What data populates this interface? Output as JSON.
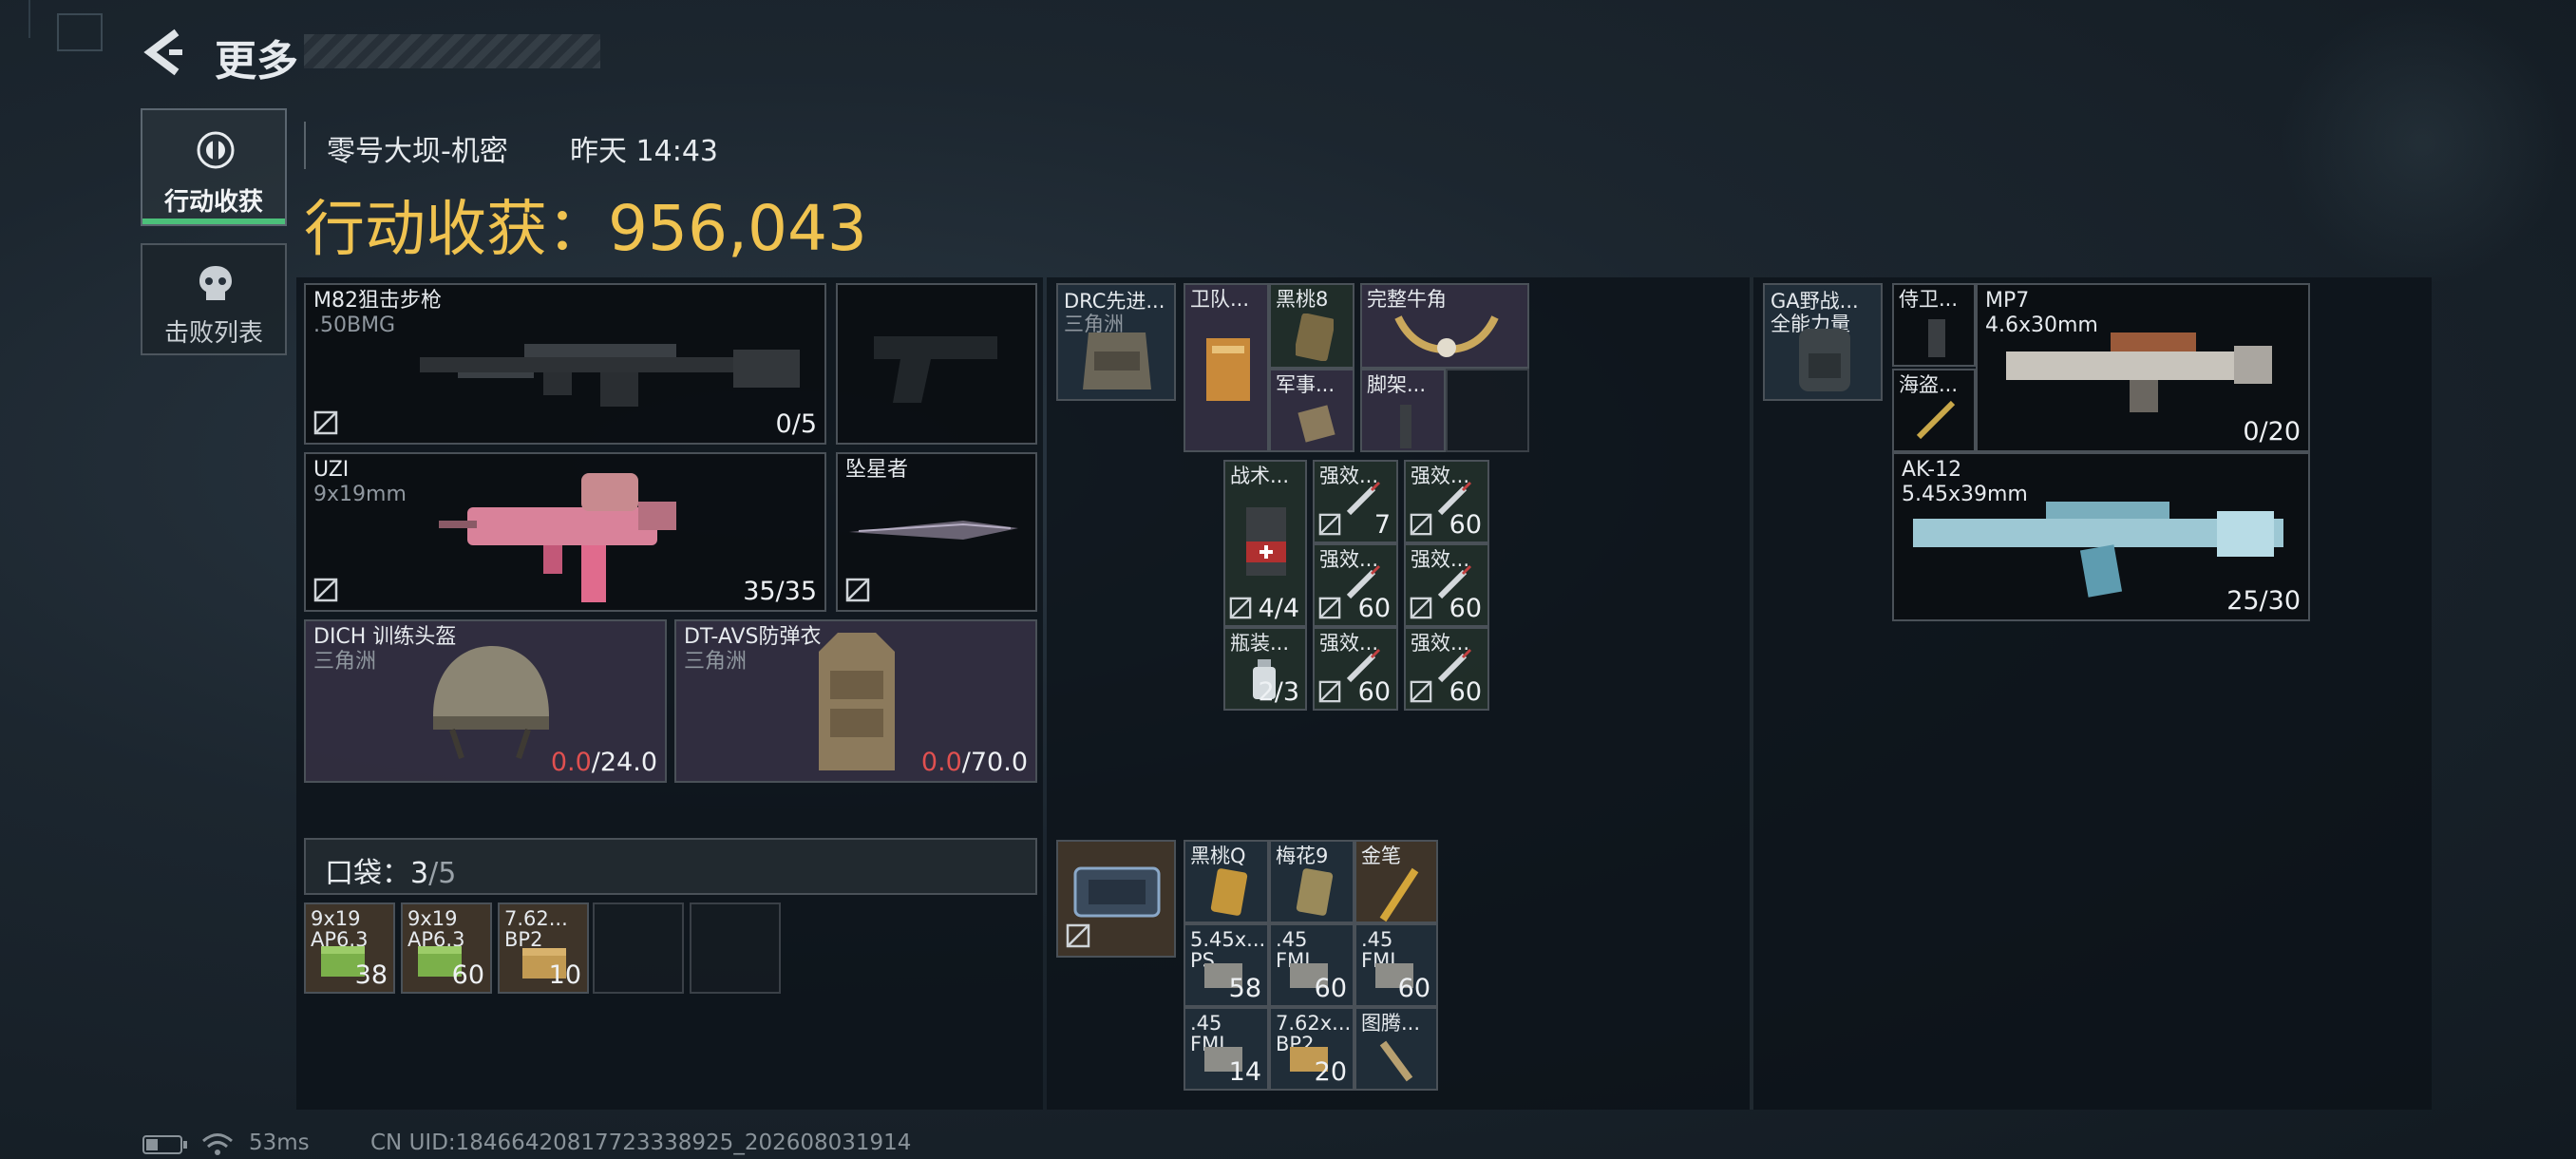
{
  "header": {
    "back_label": "更多"
  },
  "sidebar": {
    "tabs": [
      {
        "label": "行动收获",
        "icon": "loot-icon",
        "active": true
      },
      {
        "label": "击败列表",
        "icon": "skull-icon",
        "active": false
      }
    ]
  },
  "match": {
    "map": "零号大坝-机密",
    "time": "昨天 14:43"
  },
  "loot": {
    "label": "行动收获：",
    "value": "956,043"
  },
  "weapons": {
    "primary1": {
      "name": "M82狙击步枪",
      "ammo": ".50BMG",
      "count": "0/5"
    },
    "primary2": {
      "name": "UZI",
      "ammo": "9x19mm",
      "count": "35/35"
    },
    "melee": {
      "name": "坠星者"
    },
    "helmet": {
      "name": "DICH 训练头盔",
      "origin": "三角洲",
      "cur": "0.0",
      "max": "/24.0"
    },
    "armor": {
      "name": "DT-AVS防弹衣",
      "origin": "三角洲",
      "cur": "0.0",
      "max": "/70.0"
    }
  },
  "pocket": {
    "label": "口袋：",
    "current": "3",
    "total": "/5",
    "items": [
      {
        "name": "9x19",
        "sub": "AP6.3",
        "count": "38"
      },
      {
        "name": "9x19",
        "sub": "AP6.3",
        "count": "60"
      },
      {
        "name": "7.62...",
        "sub": "BP2",
        "count": "10"
      }
    ]
  },
  "chest_rig": {
    "name": "DRC先进...",
    "origin": "三角洲",
    "items": [
      {
        "name": "卫队..."
      },
      {
        "name": "黑桃8"
      },
      {
        "name": "完整牛角"
      },
      {
        "name": "军事..."
      },
      {
        "name": "脚架..."
      }
    ]
  },
  "meds": [
    {
      "name": "战术...",
      "count": "4/4"
    },
    {
      "name": "强效...",
      "count": "7"
    },
    {
      "name": "强效...",
      "count": "60"
    },
    {
      "name": "强效...",
      "count": "60"
    },
    {
      "name": "强效...",
      "count": "60"
    },
    {
      "name": "瓶装...",
      "count": "2/3"
    },
    {
      "name": "强效...",
      "count": "60"
    },
    {
      "name": "强效...",
      "count": "60"
    }
  ],
  "case_items": [
    {
      "name": "黑桃Q",
      "sub": "",
      "count": ""
    },
    {
      "name": "梅花9",
      "sub": "",
      "count": ""
    },
    {
      "name": "金笔",
      "sub": "",
      "count": ""
    },
    {
      "name": "5.45x...",
      "sub": "PS",
      "count": "58"
    },
    {
      "name": ".45",
      "sub": "FMJ",
      "count": "60"
    },
    {
      "name": ".45",
      "sub": "FMJ",
      "count": "60"
    },
    {
      "name": ".45",
      "sub": "FMJ",
      "count": "14"
    },
    {
      "name": "7.62x...",
      "sub": "BP2",
      "count": "20"
    },
    {
      "name": "图腾...",
      "sub": "",
      "count": ""
    }
  ],
  "backpack": {
    "name": "GA野战...",
    "origin": "全能力量"
  },
  "right_weapons": {
    "small1": {
      "name": "侍卫..."
    },
    "small2": {
      "name": "海盗..."
    },
    "mp7": {
      "name": "MP7",
      "ammo": "4.6x30mm",
      "count": "0/20"
    },
    "ak12": {
      "name": "AK-12",
      "ammo": "5.45x39mm",
      "count": "25/30"
    }
  },
  "status": {
    "ping": "53ms",
    "uid": "CN UID:18466420817723338925_202608031914"
  },
  "colors": {
    "accent_gold": "#f0c350",
    "active_tab_green": "#4cc07a",
    "durability_red": "#e05050"
  }
}
